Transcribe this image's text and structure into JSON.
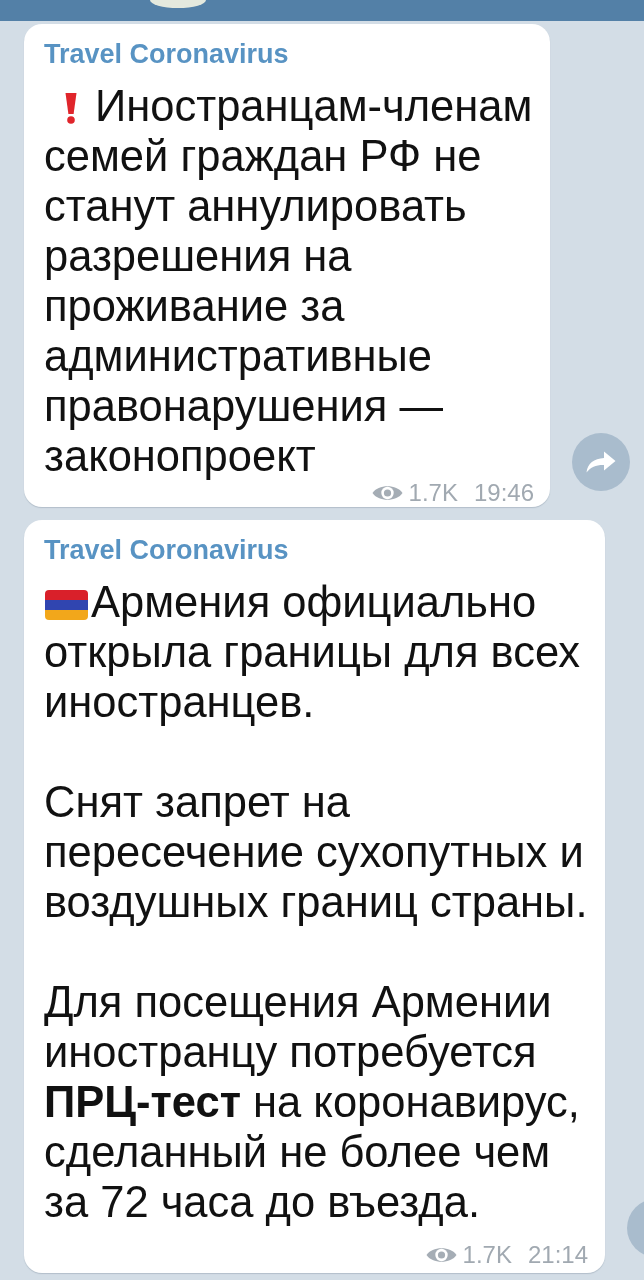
{
  "messages": [
    {
      "kind": "alert",
      "channel": "Travel Coronavirus",
      "paragraphs": [
        "Иностранцам-членам семей граждан РФ не станут аннулировать разрешения на проживание за административные правонарушения — законопроект"
      ],
      "views": "1.7K",
      "time": "19:46"
    },
    {
      "kind": "flag",
      "channel": "Travel Coronavirus",
      "paragraphs": [
        "Армения официально открыла границы для всех иностранцев.",
        "Снят запрет на пересечение сухопутных и воздушных границ страны.",
        "Для посещения Армении иностранцу потребуется **ПРЦ-тест** на коронавирус, сделанный не более чем за 72 часа до въезда."
      ],
      "views": "1.7K",
      "time": "21:14"
    }
  ]
}
